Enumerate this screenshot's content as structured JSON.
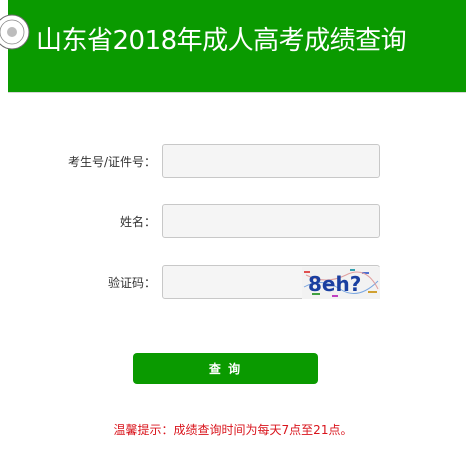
{
  "header": {
    "title": "山东省2018年成人高考成绩查询",
    "background_color": "#0a9a00",
    "logo_icon": "seal-emblem-icon"
  },
  "form": {
    "candidate_id": {
      "label": "考生号/证件号：",
      "value": "",
      "placeholder": ""
    },
    "name": {
      "label": "姓名：",
      "value": "",
      "placeholder": ""
    },
    "verification_code": {
      "label": "验证码：",
      "value": "",
      "placeholder": "",
      "captcha_text": "8eh?"
    },
    "submit_label": "查 询"
  },
  "notice": {
    "text": "温馨提示：成绩查询时间为每天7点至21点。",
    "color": "#d9141c"
  }
}
